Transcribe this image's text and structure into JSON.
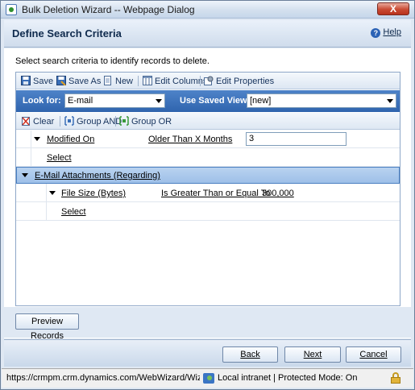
{
  "window": {
    "title": "Bulk Deletion Wizard -- Webpage Dialog",
    "close_label": "X"
  },
  "header": {
    "title": "Define Search Criteria",
    "help_label": "Help"
  },
  "instructions": "Select search criteria to identify records to delete.",
  "toolbar": {
    "save": "Save",
    "save_as": "Save As",
    "new": "New",
    "edit_columns": "Edit Columns",
    "edit_properties": "Edit Properties"
  },
  "lookbar": {
    "look_for_label": "Look for:",
    "look_for_value": "E-mail",
    "saved_view_label": "Use Saved View:",
    "saved_view_value": "[new]"
  },
  "toolbar2": {
    "clear": "Clear",
    "group_and": "Group AND",
    "group_or": "Group OR"
  },
  "criteria": {
    "row1": {
      "field": "Modified On",
      "operator": "Older Than X Months",
      "value": "3"
    },
    "select1": "Select",
    "related": "E-Mail Attachments (Regarding)",
    "row2": {
      "field": "File Size (Bytes)",
      "operator": "Is Greater Than or Equal To",
      "value": "300,000"
    },
    "select2": "Select"
  },
  "preview_button": "Preview Records",
  "footer": {
    "back": "Back",
    "next": "Next",
    "cancel": "Cancel"
  },
  "status": {
    "url": "https://crmpm.crm.dynamics.com/WebWizard/Wizard",
    "zone": "Local intranet | Protected Mode: On"
  },
  "colors": {
    "lookbar": "#2f64ae",
    "selected_row": "#9ec0e8",
    "close_button": "#c94a33"
  }
}
